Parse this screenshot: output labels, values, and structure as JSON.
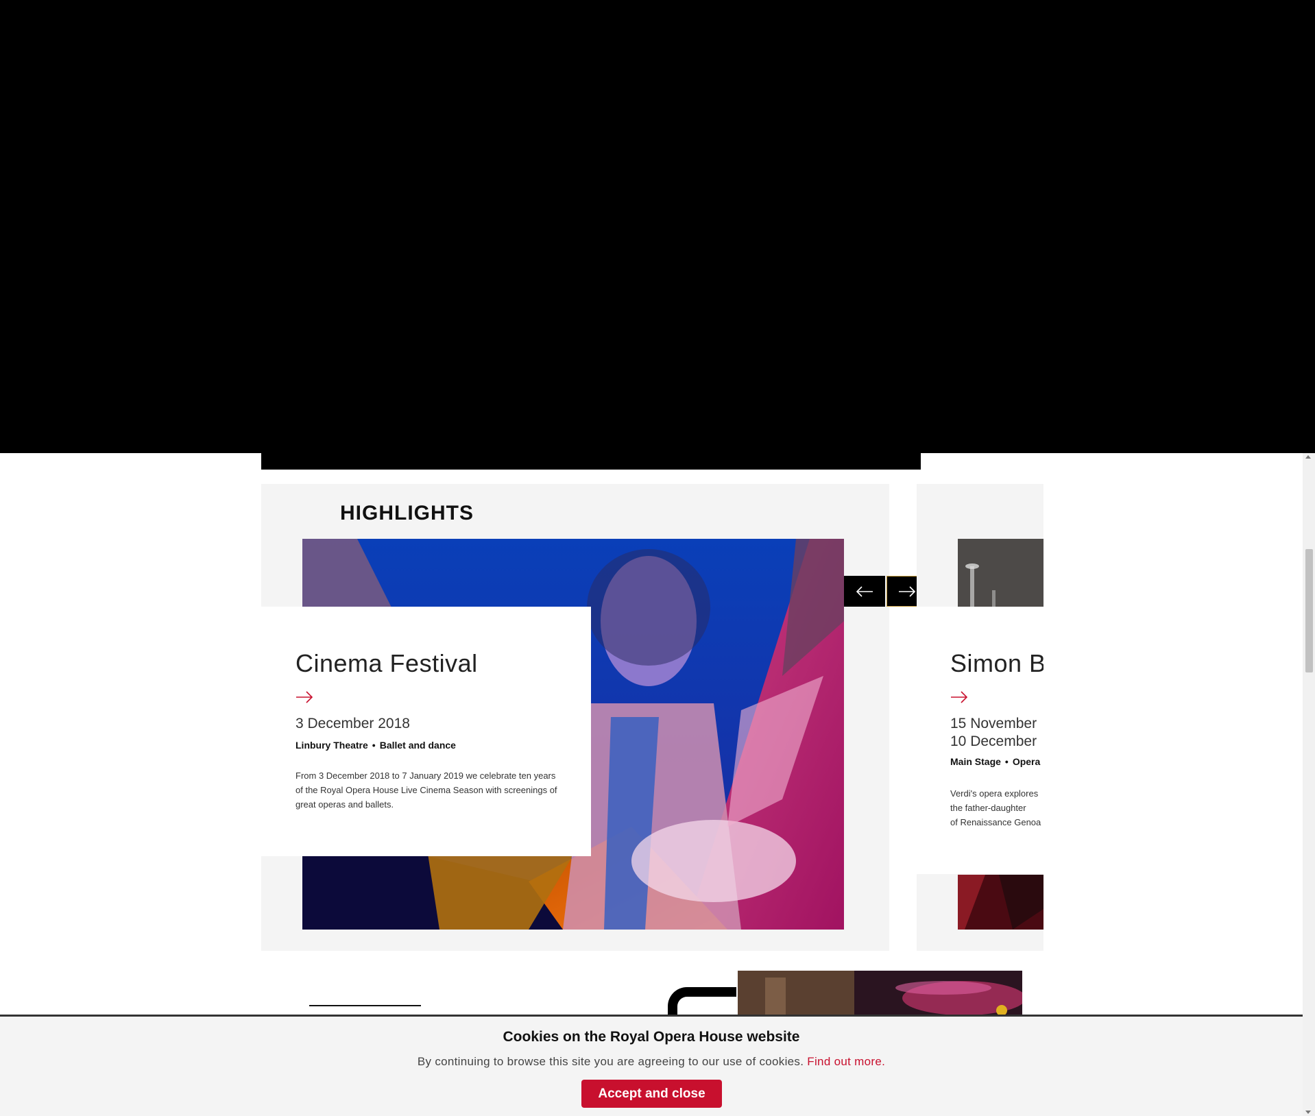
{
  "highlights": {
    "heading": "HIGHLIGHTS",
    "nav": {
      "prev_icon": "arrow-left-icon",
      "next_icon": "arrow-right-icon"
    },
    "cards": [
      {
        "title": "Cinema Festival",
        "date": "3 December 2018",
        "venue": "Linbury Theatre",
        "separator": "•",
        "category": "Ballet and dance",
        "description": "From 3 December 2018 to 7 January 2019 we celebrate ten years of the Royal Opera House Live Cinema Season with screenings of great operas and ballets."
      },
      {
        "title": "Simon Boccanegra",
        "date_line1": "15 November",
        "date_line2": "10 December",
        "venue": "Main Stage",
        "separator": "•",
        "category": "Opera",
        "description_lines": [
          "Verdi's opera explores",
          "the father-daughter",
          "of Renaissance Genoa"
        ]
      }
    ]
  },
  "cookie_banner": {
    "title": "Cookies on the Royal Opera House website",
    "text": "By continuing to browse this site you are agreeing to our use of cookies.",
    "link_text": "Find out more.",
    "button_label": "Accept and close"
  },
  "colors": {
    "accent": "#c8102e",
    "panel_bg": "#f4f4f4",
    "header_bg": "#000000"
  }
}
